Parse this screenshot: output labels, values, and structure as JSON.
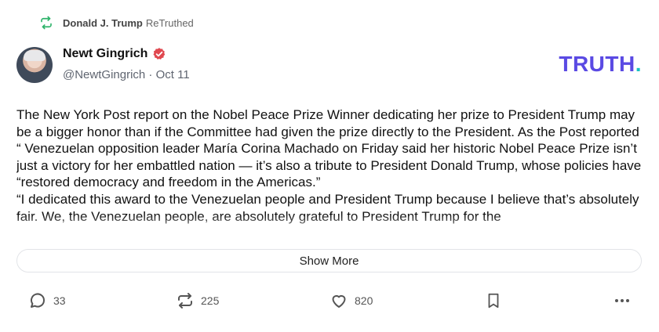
{
  "retruth": {
    "author": "Donald J. Trump",
    "label": "ReTruthed"
  },
  "post": {
    "author_name": "Newt Gingrich",
    "handle": "@NewtGingrich · Oct 11",
    "text_paragraphs": [
      "The New York Post report on the Nobel Peace Prize Winner dedicating her prize to President Trump may be a bigger honor than if the Committee had given the prize directly to the President. As the Post reported “ Venezuelan opposition leader María Corina Machado on Friday said her historic Nobel Peace Prize isn’t just a victory for her embattled nation — it’s also a tribute to President Donald Trump, whose policies have “restored democracy and freedom in the Americas.”",
      "“I dedicated this award to the Venezuelan people and President Trump because I believe that’s absolutely fair. We, the Venezuelan people, are absolutely grateful to President Trump for the"
    ],
    "show_more_label": "Show More"
  },
  "brand": {
    "logo_text": "TRUTH",
    "logo_dot": ".",
    "logo_color": "#5a4ae3",
    "dot_color": "#19c2c2"
  },
  "actions": {
    "replies": "33",
    "retruths": "225",
    "likes": "820"
  },
  "icons": [
    "retruth-icon",
    "verified-icon",
    "reply-icon",
    "retruth-icon",
    "heart-icon",
    "bookmark-icon",
    "more-icon"
  ],
  "colors": {
    "retruth_green": "#2fb36b",
    "verified": "#e0484f"
  }
}
